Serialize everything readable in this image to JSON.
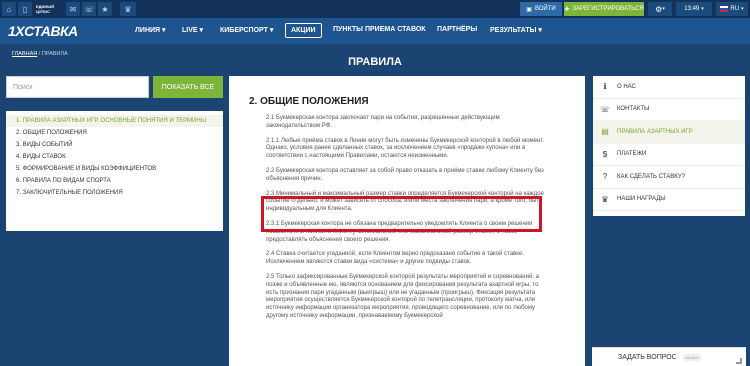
{
  "topbar": {
    "cupis": "ЕДИНЫЙ ЦУПИС",
    "login_label": "ВОЙТИ",
    "register_label": "ЗАРЕГИСТРИРОВАТЬСЯ",
    "time": "13:49",
    "lang": "RU"
  },
  "nav": {
    "logo": "1XСТАВКА",
    "items": [
      "ЛИНИЯ ▾",
      "LIVE ▾",
      "КИБЕРСПОРТ ▾",
      "АКЦИИ",
      "ПУНКТЫ ПРИЕМА СТАВОК",
      "ПАРТНЁРЫ",
      "РЕЗУЛЬТАТЫ ▾"
    ]
  },
  "breadcrumb": {
    "home": "ГЛАВНАЯ",
    "sep": " / ",
    "current": "ПРАВИЛА"
  },
  "page_title": "ПРАВИЛА",
  "search": {
    "placeholder": "Поиск",
    "button": "ПОКАЗАТЬ ВСЕ"
  },
  "left_menu": [
    "1. ПРАВИЛА АЗАРТНЫХ ИГР. ОСНОВНЫЕ ПОНЯТИЯ И ТЕРМИНЫ",
    "2. ОБЩИЕ ПОЛОЖЕНИЯ",
    "3. ВИДЫ СОБЫТИЙ",
    "4. ВИДЫ СТАВОК",
    "5. ФОРМИРОВАНИЕ И ВИДЫ КОЭФФИЦИЕНТОВ",
    "6. ПРАВИЛА ПО ВИДАМ СПОРТА",
    "7. ЗАКЛЮЧИТЕЛЬНЫЕ ПОЛОЖЕНИЯ"
  ],
  "content": {
    "title": "2. ОБЩИЕ ПОЛОЖЕНИЯ",
    "paragraphs": [
      "2.1 Букмекерская контора заключает пари на события, разрешенные действующим законодательством РФ.",
      "2.1.1 Любые приёма ставок в Линии могут быть изменены Букмекерской конторой в любой момент. Однако, условия ранее сделанных ставок, за исключением случаев «продажи купона» или в соответствии с настоящими Правилами, остаются неизменными.",
      "2.2 Букмекерская контора оставляет за собой право отказать в приёме ставки любому Клиенту без объяснения причин.",
      "2.3 Минимальный и максимальный размер ставки определяется Букмекерской конторой на каждое событие отдельно, и может зависеть от способа, и/или места заключения пари, а кроме того, быть индивидуальным для Клиента.",
      "2.3.1 Букмекерская контора не обязана предварительно уведомлять Клиента о своем решении повысить или понизить Клиенту минимальный или максимальный размер ставки, а также предоставлять объяснения своего решения.",
      "2.4 Ставка считается угаданной, если Клиентом верно предсказано событие в такой ставке. Исключением являются ставки вида «система» и другие подвиды ставок.",
      "2.5 Только зафиксированные Букмекерской конторой результаты мероприятий и соревнований, а позже и объявленные ею, являются основанием для фиксирования результата азартной игры, то есть признания пари угаданным (выигрыш) или не угаданным (проигрыш). Фиксация результата мероприятия осуществляется Букмекерской конторой по телетрансляции, протоколу матча, или источнику информации организатора мероприятия, проводящего соревнование, или по любому другому источнику информации, признаваемому Букмекерской"
    ]
  },
  "right_menu": [
    {
      "icon": "info-icon",
      "label": "О НАС"
    },
    {
      "icon": "phone-icon",
      "label": "КОНТАКТЫ"
    },
    {
      "icon": "book-icon",
      "label": "ПРАВИЛА АЗАРТНЫХ ИГР"
    },
    {
      "icon": "dollar-icon",
      "label": "ПЛАТЕЖИ"
    },
    {
      "icon": "question-icon",
      "label": "КАК СДЕЛАТЬ СТАВКУ?"
    },
    {
      "icon": "trophy-icon",
      "label": "НАШИ НАГРАДЫ"
    }
  ],
  "ask": {
    "label": "ЗАДАТЬ ВОПРОС",
    "status": "on-line"
  },
  "colors": {
    "accent_green": "#7db43a",
    "highlight_red": "#d0152a",
    "nav_blue": "#1e5590",
    "page_bg": "#1b4472"
  }
}
